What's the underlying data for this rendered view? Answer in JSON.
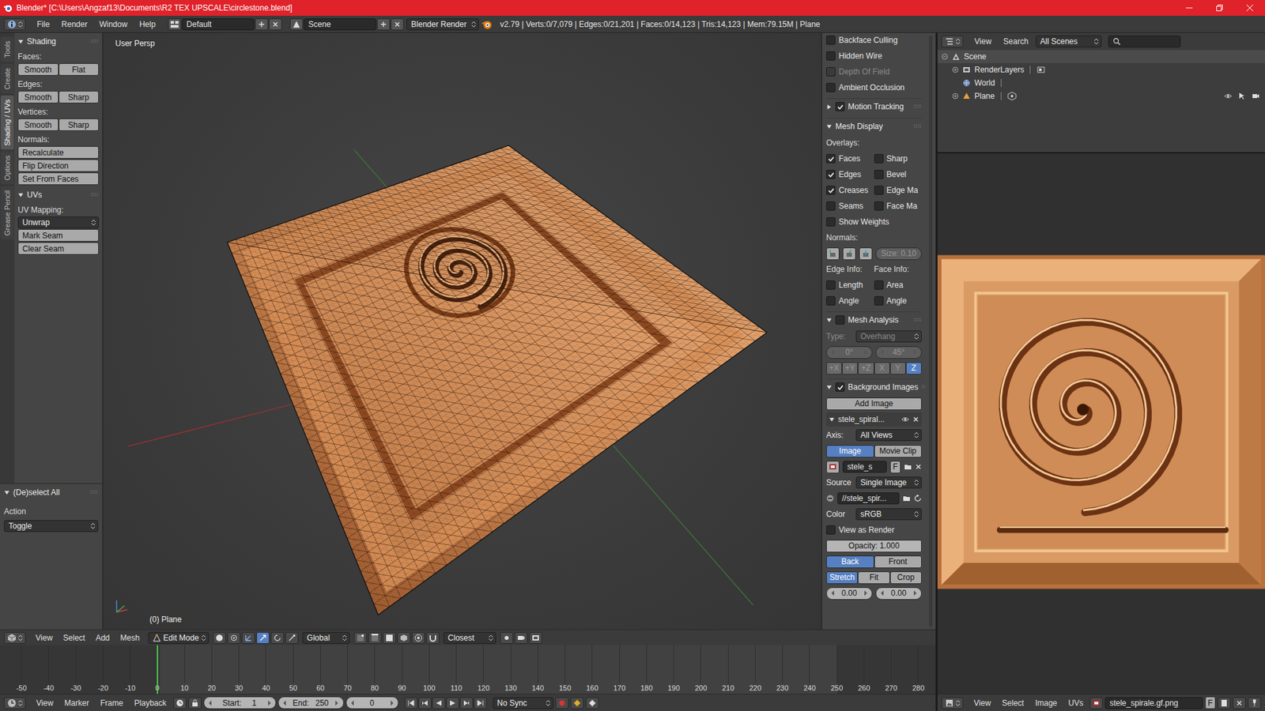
{
  "window": {
    "title": "Blender* [C:\\Users\\Angzaf13\\Documents\\R2 TEX UPSCALE\\circlestone.blend]"
  },
  "info_header": {
    "menus": [
      "File",
      "Render",
      "Window",
      "Help"
    ],
    "layout": "Default",
    "scene": "Scene",
    "engine": "Blender Render",
    "stats": "v2.79 | Verts:0/7,079 | Edges:0/21,201 | Faces:0/14,123 | Tris:14,123 | Mem:79.15M | Plane"
  },
  "tool_tabs": [
    {
      "label": "Tools",
      "selected": false
    },
    {
      "label": "Create",
      "selected": false
    },
    {
      "label": "Shading / UVs",
      "selected": true
    },
    {
      "label": "Options",
      "selected": false
    },
    {
      "label": "Grease Pencil",
      "selected": false
    }
  ],
  "tool_panel": {
    "sections": [
      {
        "title": "Shading",
        "expanded": true,
        "rows": [
          {
            "kind": "label",
            "text": "Faces:"
          },
          {
            "kind": "pair",
            "buttons": [
              "Smooth",
              "Flat"
            ]
          },
          {
            "kind": "label",
            "text": "Edges:"
          },
          {
            "kind": "pair",
            "buttons": [
              "Smooth",
              "Sharp"
            ]
          },
          {
            "kind": "label",
            "text": "Vertices:"
          },
          {
            "kind": "pair",
            "buttons": [
              "Smooth",
              "Sharp"
            ]
          },
          {
            "kind": "label",
            "text": "Normals:"
          },
          {
            "kind": "button",
            "text": "Recalculate"
          },
          {
            "kind": "button",
            "text": "Flip Direction"
          },
          {
            "kind": "button",
            "text": "Set From Faces"
          }
        ]
      },
      {
        "title": "UVs",
        "expanded": true,
        "rows": [
          {
            "kind": "label",
            "text": "UV Mapping:"
          },
          {
            "kind": "dropdown",
            "text": "Unwrap"
          },
          {
            "kind": "button",
            "text": "Mark Seam"
          },
          {
            "kind": "button",
            "text": "Clear Seam"
          }
        ]
      }
    ]
  },
  "redo_panel": {
    "title": "(De)select All",
    "expanded": true,
    "label": "Action",
    "value": "Toggle"
  },
  "viewport": {
    "view_name": "User Persp",
    "object_label": "(0) Plane"
  },
  "view3d_header": {
    "menus": [
      "View",
      "Select",
      "Add",
      "Mesh"
    ],
    "mode": "Edit Mode",
    "orientation": "Global",
    "snap": "Closest"
  },
  "properties": {
    "rows": [
      {
        "kind": "check",
        "label": "Backface Culling",
        "checked": false,
        "disabled": false
      },
      {
        "kind": "check",
        "label": "Hidden Wire",
        "checked": false,
        "disabled": false
      },
      {
        "kind": "check",
        "label": "Depth Of Field",
        "checked": false,
        "disabled": true
      },
      {
        "kind": "check",
        "label": "Ambient Occlusion",
        "checked": false,
        "disabled": false
      },
      {
        "kind": "panel",
        "title": "Motion Tracking",
        "expanded": false,
        "checkbox": true,
        "checked": true
      },
      {
        "kind": "panel",
        "title": "Mesh Display",
        "expanded": true,
        "checkbox": false,
        "checked": false
      },
      {
        "kind": "label",
        "text": "Overlays:"
      },
      {
        "kind": "check2",
        "items": [
          {
            "label": "Faces",
            "checked": true
          },
          {
            "label": "Sharp",
            "checked": false
          }
        ]
      },
      {
        "kind": "check2",
        "items": [
          {
            "label": "Edges",
            "checked": true
          },
          {
            "label": "Bevel",
            "checked": false
          }
        ]
      },
      {
        "kind": "check2",
        "items": [
          {
            "label": "Creases",
            "checked": true
          },
          {
            "label": "Edge Ma",
            "checked": false
          }
        ]
      },
      {
        "kind": "check2",
        "items": [
          {
            "label": "Seams",
            "checked": false
          },
          {
            "label": "Face Ma",
            "checked": false
          }
        ]
      },
      {
        "kind": "check",
        "label": "Show Weights",
        "checked": false,
        "disabled": false
      },
      {
        "kind": "label",
        "text": "Normals:"
      },
      {
        "kind": "normals",
        "value": "Size:  0.10",
        "disabled": true
      },
      {
        "kind": "label2",
        "texts": [
          "Edge Info:",
          "Face Info:"
        ]
      },
      {
        "kind": "check2",
        "items": [
          {
            "label": "Length",
            "checked": false
          },
          {
            "label": "Area",
            "checked": false
          }
        ]
      },
      {
        "kind": "check2",
        "items": [
          {
            "label": "Angle",
            "checked": false
          },
          {
            "label": "Angle",
            "checked": false
          }
        ]
      },
      {
        "kind": "panel",
        "title": "Mesh Analysis",
        "expanded": true,
        "checkbox": true,
        "checked": false
      },
      {
        "kind": "select",
        "label": "Type:",
        "value": "Overhang",
        "disabled": true
      },
      {
        "kind": "numbers",
        "values": [
          "0°",
          "45°"
        ],
        "disabled": true
      },
      {
        "kind": "toggles",
        "disabled": true,
        "items": [
          {
            "label": "+X",
            "selected": false
          },
          {
            "label": "+Y",
            "selected": false
          },
          {
            "label": "+Z",
            "selected": false
          },
          {
            "label": "X",
            "selected": false
          },
          {
            "label": "Y",
            "selected": false
          },
          {
            "label": "Z",
            "selected": true
          }
        ]
      },
      {
        "kind": "panel",
        "title": "Background Images",
        "expanded": true,
        "checkbox": true,
        "checked": true
      },
      {
        "kind": "button",
        "text": "Add Image"
      },
      {
        "kind": "bgitem",
        "name": "stele_spiral...",
        "expanded": true
      },
      {
        "kind": "select",
        "label": "Axis:",
        "value": "All Views",
        "disabled": false
      },
      {
        "kind": "toggles",
        "disabled": false,
        "items": [
          {
            "label": "Image",
            "selected": true
          },
          {
            "label": "Movie Clip",
            "selected": false
          }
        ]
      },
      {
        "kind": "datablock",
        "value": "stele_s",
        "extra": "F"
      },
      {
        "kind": "select",
        "label": "Source",
        "value": "Single Image",
        "disabled": false
      },
      {
        "kind": "filepath",
        "value": "//stele_spir..."
      },
      {
        "kind": "select",
        "label": "Color",
        "value": "sRGB",
        "disabled": false
      },
      {
        "kind": "check",
        "label": "View as Render",
        "checked": false,
        "disabled": false
      },
      {
        "kind": "slider",
        "text": "Opacity:  1.000",
        "level": 1
      },
      {
        "kind": "toggles",
        "disabled": false,
        "items": [
          {
            "label": "Back",
            "selected": true
          },
          {
            "label": "Front",
            "selected": false
          }
        ]
      },
      {
        "kind": "toggles",
        "disabled": false,
        "items": [
          {
            "label": "Stretch",
            "selected": true
          },
          {
            "label": "Fit",
            "selected": false
          },
          {
            "label": "Crop",
            "selected": false
          }
        ]
      },
      {
        "kind": "numbers",
        "values": [
          "0.00",
          "0.00"
        ],
        "disabled": false
      }
    ]
  },
  "timeline": {
    "ticks": [
      "-50",
      "-40",
      "-30",
      "-20",
      "-10",
      "0",
      "10",
      "20",
      "30",
      "40",
      "50",
      "60",
      "70",
      "80",
      "90",
      "100",
      "110",
      "120",
      "130",
      "140",
      "150",
      "160",
      "170",
      "180",
      "190",
      "200",
      "210",
      "220",
      "230",
      "240",
      "250",
      "260",
      "270",
      "280"
    ],
    "current_frame": "0"
  },
  "timeline_header": {
    "menus": [
      "View",
      "Marker",
      "Frame",
      "Playback"
    ],
    "start_label": "Start:",
    "start": "1",
    "end_label": "End:",
    "end": "250",
    "frame": "0",
    "sync": "No Sync"
  },
  "outliner": {
    "menus": [
      "View",
      "Search"
    ],
    "display": "All Scenes",
    "tree": {
      "label": "Scene",
      "kind": "scene",
      "expanded": true,
      "selected": true,
      "children": [
        {
          "label": "RenderLayers",
          "kind": "renderlayers",
          "expandable": true,
          "expanded": false,
          "selected": false
        },
        {
          "label": "World",
          "kind": "world",
          "expandable": false,
          "expanded": false,
          "selected": false
        },
        {
          "label": "Plane",
          "kind": "object",
          "expandable": true,
          "expanded": false,
          "selected": false,
          "visible": true,
          "selectable": true,
          "renderable": true
        }
      ]
    }
  },
  "image_editor": {
    "menus": [
      "View",
      "Select",
      "Image",
      "UVs"
    ],
    "image": "stele_spirale.gf.png",
    "extra": "F"
  }
}
